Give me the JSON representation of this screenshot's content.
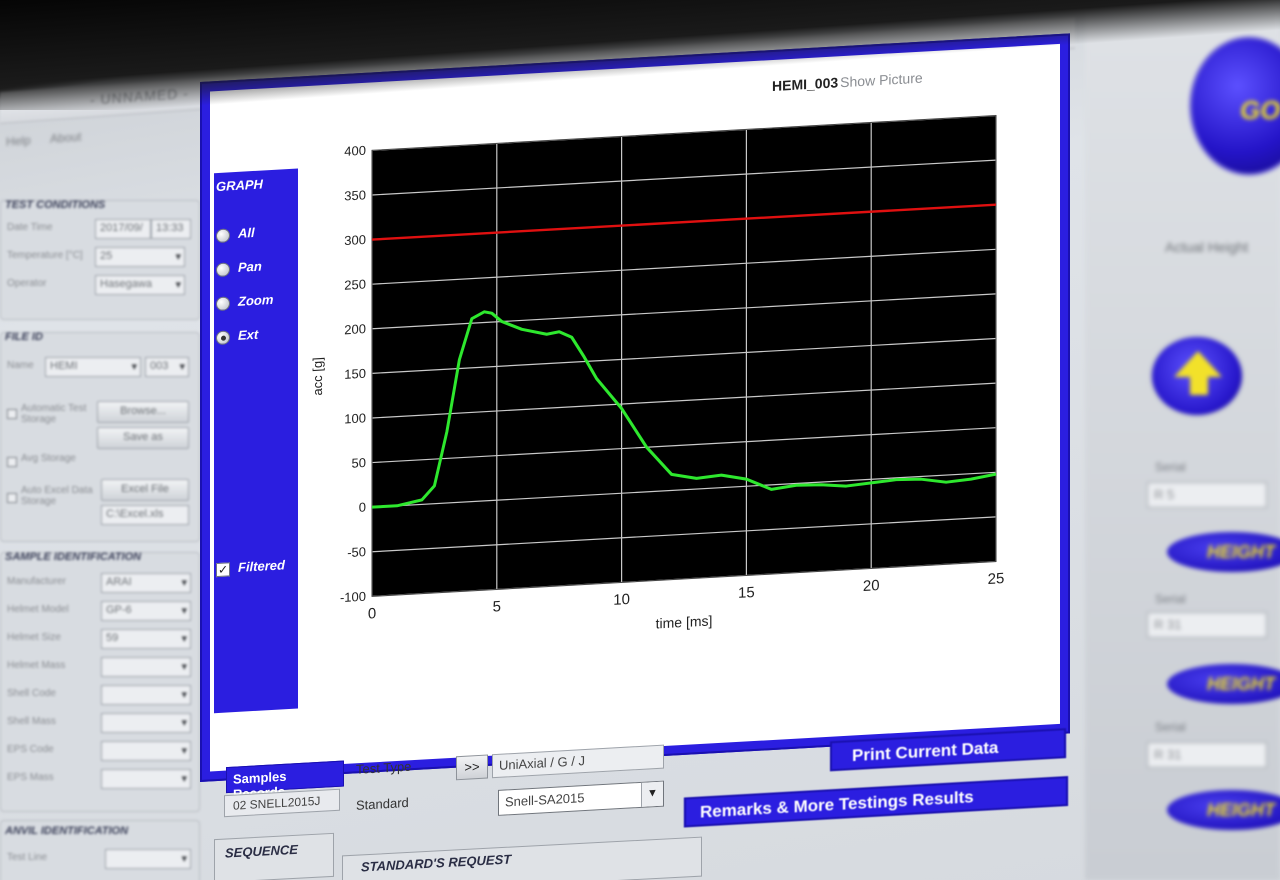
{
  "window": {
    "title": "- UNNAMED -",
    "menu": [
      "Help",
      "About"
    ]
  },
  "left_panel": {
    "test_conditions": {
      "title": "TEST CONDITIONS",
      "datetime_label": "Date Time",
      "date": "2017/09/",
      "time": "13:33",
      "temperature_label": "Temperature [°C]",
      "temperature": "25",
      "operator_label": "Operator",
      "operator": "Hasegawa"
    },
    "file_id": {
      "title": "FILE ID",
      "name_label": "Name",
      "name": "HEMI",
      "number": "003",
      "auto_test_label": "Automatic Test Storage",
      "browse": "Browse...",
      "save_as": "Save as",
      "avg_storage": "Avg Storage",
      "auto_excel_label": "Auto Excel Data Storage",
      "excel_file": "Excel File",
      "excel_path": "C:\\Excel.xls"
    },
    "sample_identification": {
      "title": "SAMPLE IDENTIFICATION",
      "rows": [
        {
          "label": "Manufacturer",
          "value": "ARAI"
        },
        {
          "label": "Helmet Model",
          "value": "GP-6"
        },
        {
          "label": "Helmet Size",
          "value": "59"
        },
        {
          "label": "Helmet Mass",
          "value": ""
        },
        {
          "label": "Shell Code",
          "value": ""
        },
        {
          "label": "Shell Mass",
          "value": ""
        },
        {
          "label": "EPS Code",
          "value": ""
        },
        {
          "label": "EPS Mass",
          "value": ""
        }
      ]
    },
    "anvil_identification": {
      "title": "ANVIL IDENTIFICATION",
      "test_line_label": "Test Line"
    }
  },
  "graph": {
    "panel_title": "GRAPH",
    "options": [
      "All",
      "Pan",
      "Zoom",
      "Ext"
    ],
    "selected_option": "Ext",
    "filtered_label": "Filtered",
    "filtered_checked": true,
    "file_label": "HEMI_003",
    "show_picture": "Show Picture"
  },
  "chart_data": {
    "type": "line",
    "xlabel": "time [ms]",
    "ylabel": "acc [g]",
    "xlim": [
      0,
      25
    ],
    "ylim": [
      -100,
      400
    ],
    "x_ticks": [
      0,
      5,
      10,
      15,
      20,
      25
    ],
    "y_ticks": [
      400,
      350,
      300,
      250,
      200,
      150,
      100,
      50,
      0,
      -50,
      -100
    ],
    "grid": true,
    "colors": {
      "background": "#000000",
      "grid": "#c9c9c9",
      "signal": "#2ee82e",
      "threshold": "#e01010"
    },
    "series": [
      {
        "color": "#2ee82e",
        "x": [
          0,
          1,
          2,
          2.5,
          3,
          3.5,
          4,
          4.5,
          4.8,
          5.2,
          6,
          7,
          7.5,
          8,
          8.5,
          9,
          10,
          11,
          12,
          13,
          14,
          15,
          16,
          17,
          18,
          19,
          20,
          21,
          22,
          23,
          24,
          25
        ],
        "y": [
          0,
          0,
          5,
          20,
          80,
          160,
          205,
          212,
          210,
          200,
          190,
          183,
          185,
          178,
          155,
          130,
          95,
          50,
          18,
          12,
          14,
          8,
          -5,
          -2,
          -3,
          -6,
          -4,
          -2,
          -3,
          -8,
          -6,
          -2
        ]
      },
      {
        "color": "#e01010",
        "x": [
          0,
          25
        ],
        "y": [
          300,
          300
        ]
      }
    ]
  },
  "lower_panel": {
    "samples_records_label": "Samples Records",
    "samples_records_value": "02 SNELL2015J",
    "test_type_label": "Test Type",
    "arrow_button": ">>",
    "test_type_value": "UniAxial / G / J",
    "standard_label": "Standard",
    "standard_value": "Snell-SA2015",
    "print_button": "Print Current Data",
    "remarks_button": "Remarks & More Testings Results",
    "sequence_title": "SEQUENCE",
    "standards_request_title": "STANDARD'S REQUEST"
  },
  "right_panel": {
    "go_label": "GO",
    "actual_height_label": "Actual Height",
    "serial_label": "Serial",
    "serial_values": [
      "R 5",
      "R 31",
      "R 31"
    ],
    "height_buttons": [
      "HEIGHT",
      "HEIGHT",
      "HEIGHT"
    ]
  }
}
